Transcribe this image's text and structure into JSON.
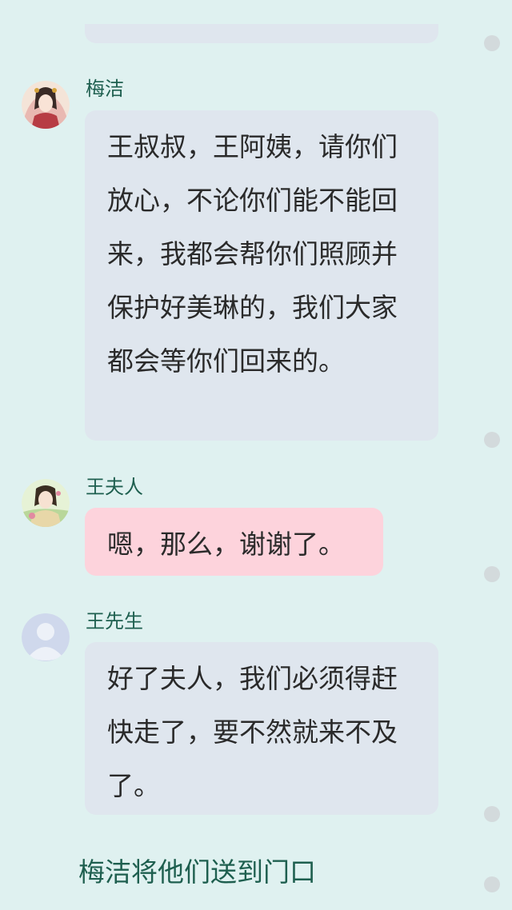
{
  "messages": [
    {
      "sender": "梅洁",
      "avatar_icon": "ancient-woman-avatar-icon",
      "text": "王叔叔，王阿姨，请你们放心，不论你们能不能回来，我都会帮你们照顾并保护好美琳的，我们大家都会等你们回来的。",
      "bubble_color": "#dfe6ee"
    },
    {
      "sender": "王夫人",
      "avatar_icon": "lady-with-flower-avatar-icon",
      "text": "嗯，那么，谢谢了。",
      "bubble_color": "#fdd3dc"
    },
    {
      "sender": "王先生",
      "avatar_icon": "default-user-avatar-icon",
      "text": "好了夫人，我们必须得赶快走了，要不然就来不及了。",
      "bubble_color": "#dfe6ee"
    }
  ],
  "narration": "梅洁将他们送到门口",
  "colors": {
    "background": "#dff1f0",
    "sender_name": "#1e5f4f",
    "narration": "#1e5f4f",
    "bubble_default": "#dfe6ee",
    "bubble_pink": "#fdd3dc"
  }
}
